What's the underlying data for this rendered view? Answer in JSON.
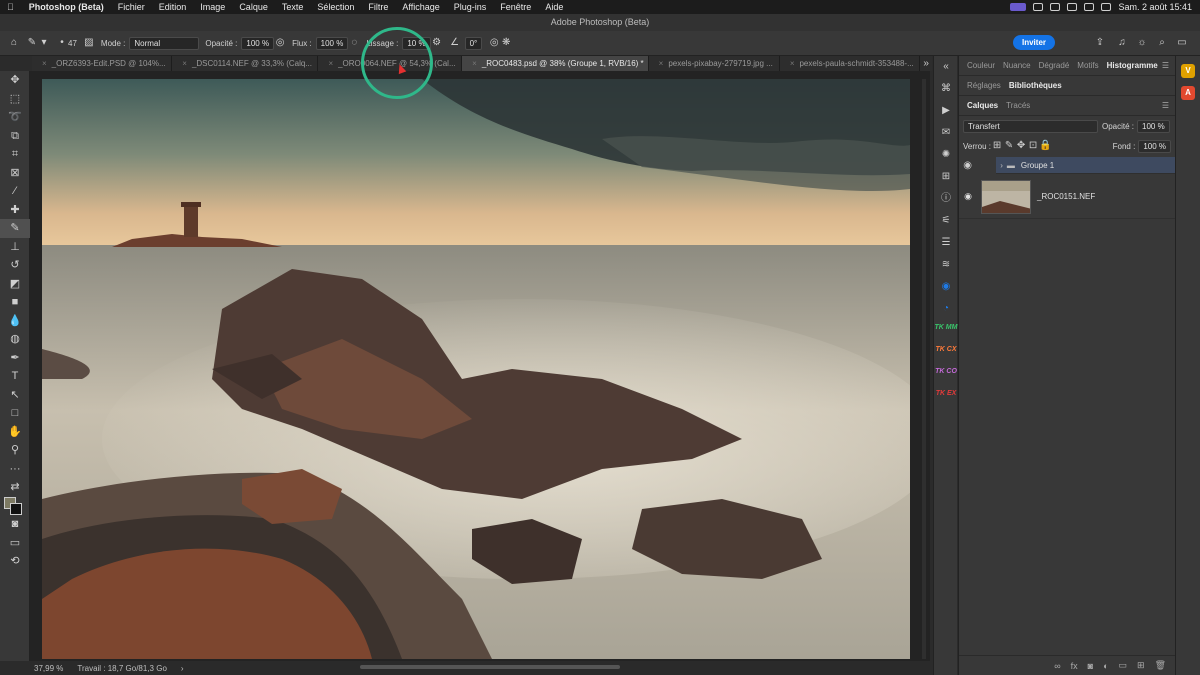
{
  "menubar": {
    "app": "Photoshop (Beta)",
    "items": [
      "Fichier",
      "Edition",
      "Image",
      "Calque",
      "Texte",
      "Sélection",
      "Filtre",
      "Affichage",
      "Plug-ins",
      "Fenêtre",
      "Aide"
    ],
    "clock": "Sam. 2 août  15:41"
  },
  "window": {
    "title": "Adobe Photoshop (Beta)"
  },
  "options": {
    "size": "47",
    "mode_label": "Mode :",
    "mode_value": "Normal",
    "opacity_label": "Opacité :",
    "opacity_value": "100 %",
    "flux_label": "Flux :",
    "flux_value": "100 %",
    "lissage_label": "Lissage :",
    "lissage_value": "10 %",
    "angle_value": "0°",
    "invite_label": "Inviter"
  },
  "tabs": [
    {
      "label": "_ORZ6393-Edit.PSD @ 104%...",
      "active": false
    },
    {
      "label": "_DSC0114.NEF @ 33,3% (Calq...",
      "active": false
    },
    {
      "label": "_ORO0064.NEF @ 54,3% (Cal...",
      "active": false
    },
    {
      "label": "_ROC0483.psd @ 38% (Groupe 1, RVB/16) *",
      "active": true
    },
    {
      "label": "pexels-pixabay-279719.jpg ...",
      "active": false
    },
    {
      "label": "pexels-paula-schmidt-353488-...",
      "active": false
    }
  ],
  "status": {
    "zoom": "37,99 %",
    "work": "Travail : 18,7 Go/81,3 Go",
    "arrow": "›"
  },
  "panel_top": {
    "tabs": [
      "Couleur",
      "Nuance",
      "Dégradé",
      "Motifs",
      "Histogramme"
    ],
    "active": "Histogramme"
  },
  "panel_mid": {
    "tabs": [
      "Réglages",
      "Bibliothèques"
    ],
    "active": "Bibliothèques"
  },
  "panel_layers": {
    "tabs": [
      "Calques",
      "Tracés"
    ],
    "blend": "Transfert",
    "opacity_label": "Opacité :",
    "opacity_value": "100 %",
    "lock_label": "Verrou :",
    "fill_label": "Fond :",
    "fill_value": "100 %",
    "layers": [
      {
        "name": "Groupe 1",
        "type": "group"
      },
      {
        "name": "_ROC0151.NEF",
        "type": "image"
      }
    ]
  },
  "tk_badges": [
    "TK MM",
    "TK CX",
    "TK CO",
    "TK EX"
  ],
  "colors": {
    "accent": "#1473e6",
    "highlight_ring": "#2fb88a",
    "layer_selected": "#3e4a60"
  }
}
